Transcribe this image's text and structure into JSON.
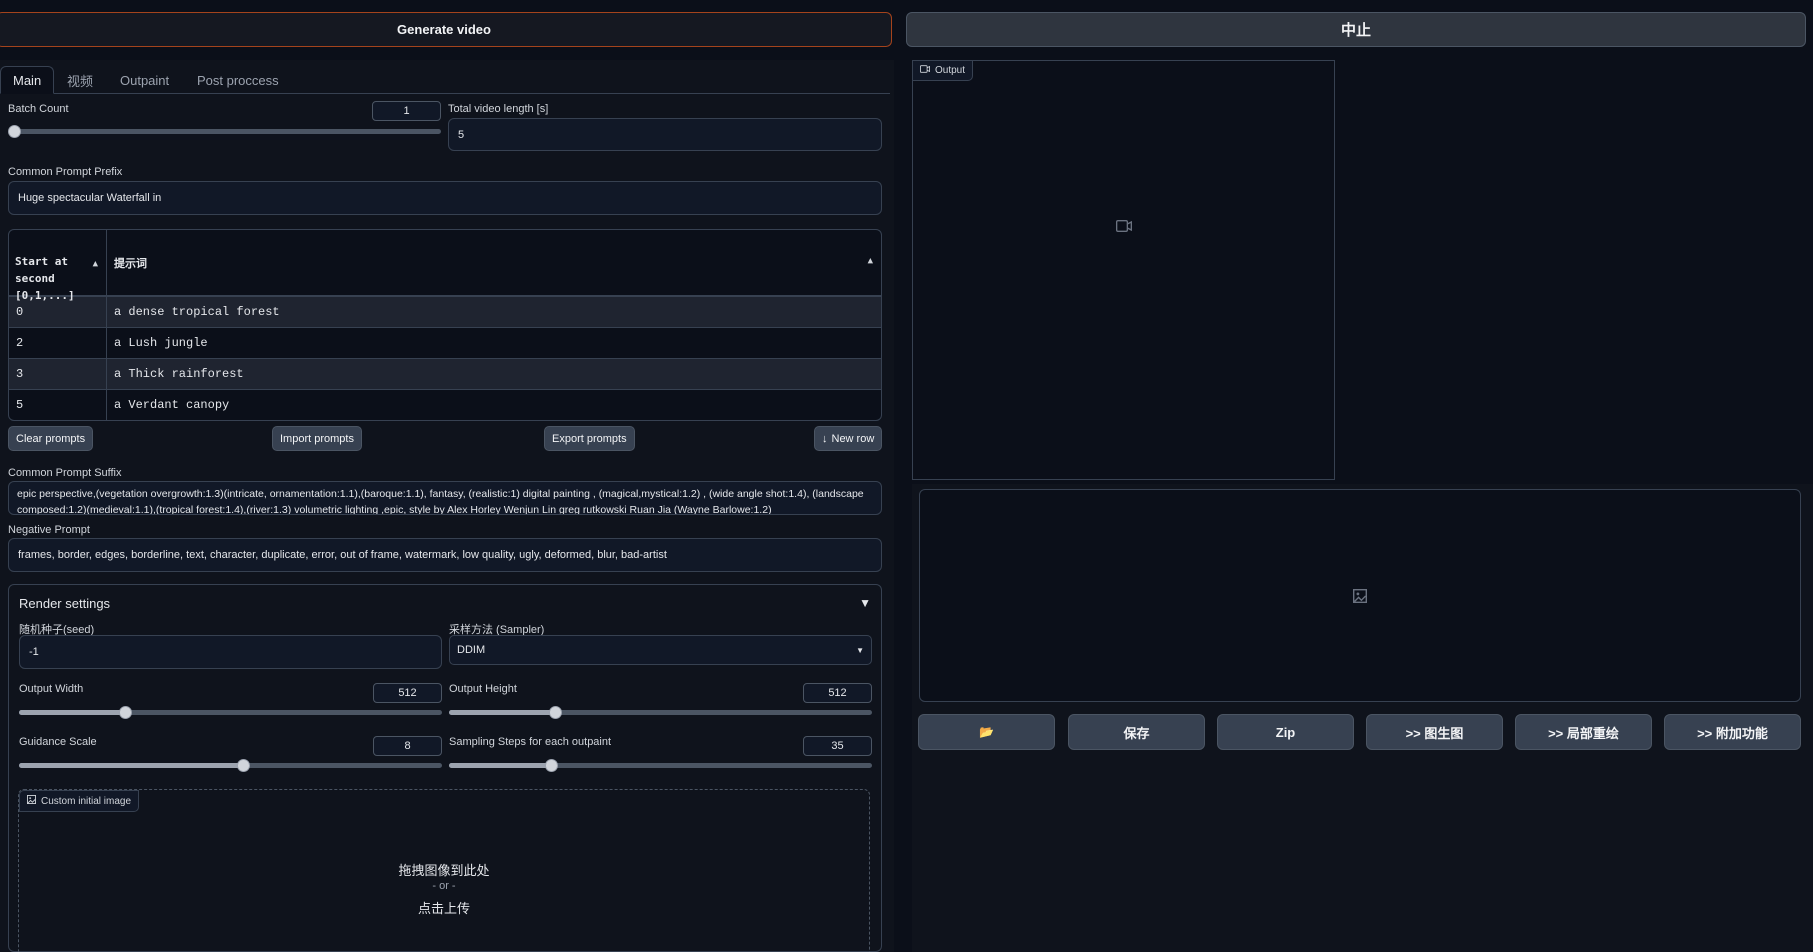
{
  "top": {
    "generate_label": "Generate video",
    "stop_label": "中止"
  },
  "tabs": [
    "Main",
    "视频",
    "Outpaint",
    "Post proccess"
  ],
  "main": {
    "batch_count": {
      "label": "Batch Count",
      "value": "1",
      "fraction": 0.0
    },
    "total_video_length": {
      "label": "Total video length [s]",
      "value": "5"
    },
    "prefix": {
      "label": "Common Prompt Prefix",
      "value": "Huge spectacular Waterfall in"
    },
    "table": {
      "headers": [
        "Start at\nsecond\n[0,1,...]",
        "提示词"
      ],
      "rows": [
        [
          "0",
          "a dense tropical forest"
        ],
        [
          "2",
          "a Lush jungle"
        ],
        [
          "3",
          "a Thick rainforest"
        ],
        [
          "5",
          "a Verdant canopy"
        ]
      ]
    },
    "buttons": {
      "clear": "Clear prompts",
      "import": "Import prompts",
      "export": "Export prompts",
      "new_row": "New row",
      "new_row_icon": "↓"
    },
    "suffix": {
      "label": "Common Prompt Suffix",
      "value": "epic perspective,(vegetation overgrowth:1.3)(intricate, ornamentation:1.1),(baroque:1.1), fantasy, (realistic:1) digital painting , (magical,mystical:1.2) , (wide angle shot:1.4), (landscape composed:1.2)(medieval:1.1),(tropical forest:1.4),(river:1.3) volumetric lighting ,epic, style by Alex Horley Wenjun Lin greg rutkowski Ruan Jia (Wayne Barlowe:1.2)"
    },
    "negative": {
      "label": "Negative Prompt",
      "value": "frames, border, edges, borderline, text, character, duplicate, error, out of frame, watermark, low quality, ugly, deformed, blur, bad-artist"
    }
  },
  "render": {
    "title": "Render settings",
    "collapse_icon": "▼",
    "seed": {
      "label": "随机种子(seed)",
      "value": "-1"
    },
    "sampler": {
      "label": "采样方法 (Sampler)",
      "value": "DDIM"
    },
    "width": {
      "label": "Output Width",
      "value": "512",
      "fraction": 0.25
    },
    "height": {
      "label": "Output Height",
      "value": "512",
      "fraction": 0.25
    },
    "guidance": {
      "label": "Guidance Scale",
      "value": "8",
      "fraction": 0.53
    },
    "steps": {
      "label": "Sampling Steps for each outpaint",
      "value": "35",
      "fraction": 0.24
    },
    "upload": {
      "tag": "Custom initial image",
      "drop": "拖拽图像到此处",
      "or": "- or -",
      "click": "点击上传"
    }
  },
  "output": {
    "tag": "Output"
  },
  "actions": [
    "📂",
    "保存",
    "Zip",
    ">> 图生图",
    ">> 局部重绘",
    ">> 附加功能"
  ]
}
